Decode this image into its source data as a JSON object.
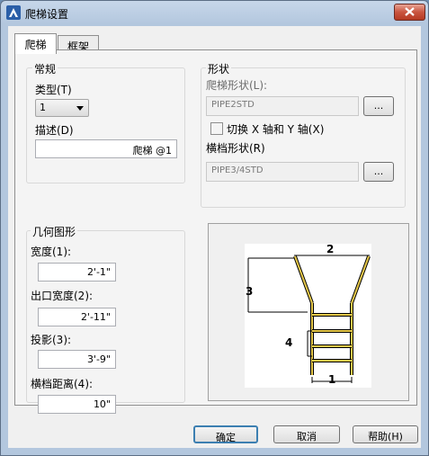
{
  "window": {
    "title": "爬梯设置",
    "app_icon": "autocad-a-icon",
    "close_icon": "close-x-icon"
  },
  "tabs": [
    {
      "label": "爬梯",
      "active": true
    },
    {
      "label": "框架",
      "active": false
    }
  ],
  "general": {
    "group_label": "常规",
    "type_label": "类型(T)",
    "type_value": "1",
    "desc_label": "描述(D)",
    "desc_value": "爬梯 @1"
  },
  "shape": {
    "group_label": "形状",
    "ladder_shape_label": "爬梯形状(L):",
    "ladder_shape_value": "PIPE2STD",
    "browse1": "...",
    "swap_label": "切换 X 轴和 Y 轴(X)",
    "swap_checked": false,
    "rung_shape_label": "横档形状(R)",
    "rung_shape_value": "PIPE3/4STD",
    "browse2": "..."
  },
  "geometry": {
    "group_label": "几何图形",
    "width_label": "宽度(1):",
    "width_value": "2'-1\"",
    "exit_width_label": "出口宽度(2):",
    "exit_width_value": "2'-11\"",
    "projection_label": "投影(3):",
    "projection_value": "3'-9\"",
    "rung_spacing_label": "横档距离(4):",
    "rung_spacing_value": "10\""
  },
  "preview": {
    "dim1": "1",
    "dim2": "2",
    "dim3": "3",
    "dim4": "4",
    "accent": "#e6c84a"
  },
  "buttons": {
    "ok": "确定",
    "cancel": "取消",
    "help": "帮助(H)"
  }
}
